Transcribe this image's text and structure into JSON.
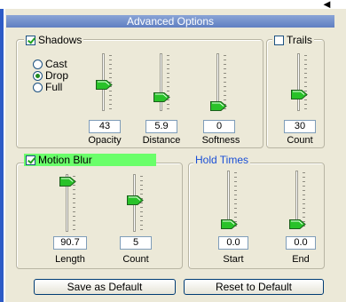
{
  "title": "Advanced Options",
  "shadows": {
    "label": "Shadows",
    "checked": true,
    "options": [
      {
        "label": "Cast",
        "selected": false
      },
      {
        "label": "Drop",
        "selected": true
      },
      {
        "label": "Full",
        "selected": false
      }
    ],
    "sliders": [
      {
        "label": "Opacity",
        "value": "43"
      },
      {
        "label": "Distance",
        "value": "5.9"
      },
      {
        "label": "Softness",
        "value": "0"
      }
    ]
  },
  "trails": {
    "label": "Trails",
    "checked": false,
    "slider": {
      "label": "Count",
      "value": "30"
    }
  },
  "motion_blur": {
    "label": "Motion Blur",
    "checked": true,
    "sliders": [
      {
        "label": "Length",
        "value": "90.7"
      },
      {
        "label": "Count",
        "value": "5"
      }
    ]
  },
  "hold_times": {
    "label": "Hold Times",
    "sliders": [
      {
        "label": "Start",
        "value": "0.0"
      },
      {
        "label": "End",
        "value": "0.0"
      }
    ]
  },
  "buttons": {
    "save_default": "Save as Default",
    "reset_default": "Reset to Default"
  },
  "colors": {
    "title_bar": "#6f8ccb",
    "motion_blur_highlight": "#6aff6a",
    "hold_times_label": "#1a4fd6",
    "thumb_fill": "#29c229"
  }
}
